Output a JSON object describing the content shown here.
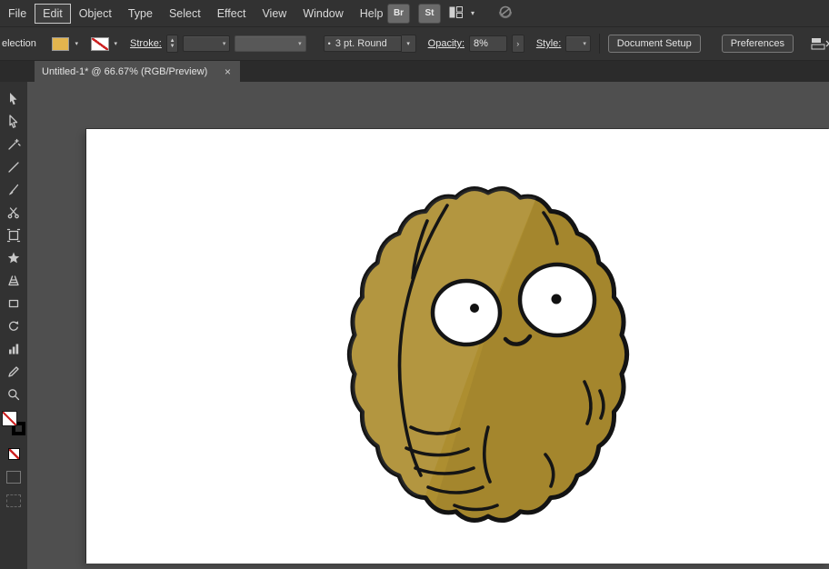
{
  "menu": {
    "items": [
      "File",
      "Edit",
      "Object",
      "Type",
      "Select",
      "Effect",
      "View",
      "Window",
      "Help"
    ],
    "active_item": "Edit"
  },
  "appbar": {
    "bridge_label": "Br",
    "stock_label": "St"
  },
  "icons": {
    "chevron_down": "▾",
    "chevron_right": "›",
    "stepper_up": "▲",
    "stepper_down": "▼",
    "bullet": "•",
    "close": "×"
  },
  "control_bar": {
    "selection_label": "election",
    "fill_color": "#e3b54e",
    "stroke_label": "Stroke:",
    "brush_value": "3 pt. Round",
    "opacity_label": "Opacity:",
    "opacity_value": "8%",
    "style_label": "Style:",
    "document_setup_label": "Document Setup",
    "preferences_label": "Preferences"
  },
  "tab": {
    "title": "Untitled-1* @ 66.67% (RGB/Preview)"
  },
  "tools": [
    "selection",
    "direct-selection",
    "magic-wand",
    "line-segment",
    "paintbrush",
    "scissors",
    "free-transform",
    "shape-builder",
    "perspective-grid",
    "rectangle",
    "rotate",
    "column-graph",
    "pencil",
    "zoom"
  ],
  "canvas": {
    "workspace_color": "#4f4f4f",
    "artboard_color": "#ffffff"
  },
  "wallnut": {
    "body_color": "#ad8e30",
    "outline_color": "#141414",
    "eye_color": "#ffffff",
    "pupil_color": "#111111"
  }
}
